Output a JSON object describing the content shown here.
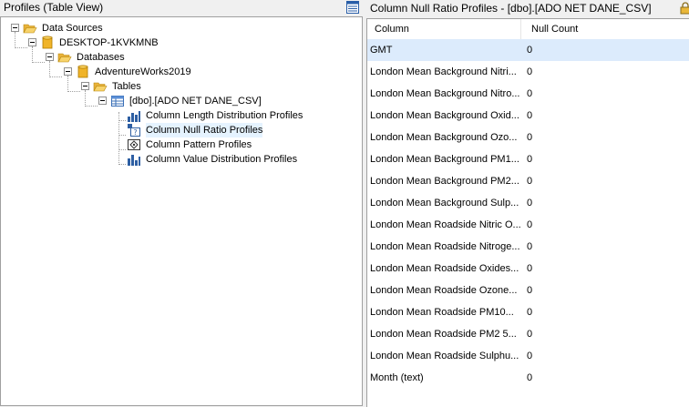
{
  "left_panel": {
    "title": "Profiles (Table View)",
    "header_icon": "table-view-icon"
  },
  "tree": {
    "data_sources": "Data Sources",
    "server": "DESKTOP-1KVKMNB",
    "databases": "Databases",
    "database": "AdventureWorks2019",
    "tables": "Tables",
    "table": "[dbo].[ADO NET DANE_CSV]",
    "profiles": [
      {
        "label": "Column Length Distribution Profiles",
        "icon": "length-distribution-icon"
      },
      {
        "label": "Column Null Ratio Profiles",
        "icon": "null-ratio-icon"
      },
      {
        "label": "Column Pattern Profiles",
        "icon": "pattern-icon"
      },
      {
        "label": "Column Value Distribution Profiles",
        "icon": "value-distribution-icon"
      }
    ]
  },
  "right_panel": {
    "title": "Column Null Ratio Profiles  -  [dbo].[ADO NET DANE_CSV]",
    "columns": [
      "Column",
      "Null Count"
    ],
    "rows": [
      {
        "column": "GMT",
        "null_count": "0"
      },
      {
        "column": "London Mean Background Nitri...",
        "null_count": "0"
      },
      {
        "column": "London Mean Background Nitro...",
        "null_count": "0"
      },
      {
        "column": "London Mean Background Oxid...",
        "null_count": "0"
      },
      {
        "column": "London Mean Background Ozo...",
        "null_count": "0"
      },
      {
        "column": "London Mean Background PM1...",
        "null_count": "0"
      },
      {
        "column": "London Mean Background PM2...",
        "null_count": "0"
      },
      {
        "column": "London Mean Background Sulp...",
        "null_count": "0"
      },
      {
        "column": "London Mean Roadside Nitric O...",
        "null_count": "0"
      },
      {
        "column": "London Mean Roadside Nitroge...",
        "null_count": "0"
      },
      {
        "column": "London Mean Roadside Oxides...",
        "null_count": "0"
      },
      {
        "column": "London Mean Roadside Ozone...",
        "null_count": "0"
      },
      {
        "column": "London Mean Roadside PM10...",
        "null_count": "0"
      },
      {
        "column": "London Mean Roadside PM2 5...",
        "null_count": "0"
      },
      {
        "column": "London Mean Roadside Sulphu...",
        "null_count": "0"
      },
      {
        "column": "Month (text)",
        "null_count": "0"
      }
    ]
  },
  "colors": {
    "selected_row": "#dcebfc",
    "folder": "#f5c542",
    "database": "#e8a317"
  }
}
